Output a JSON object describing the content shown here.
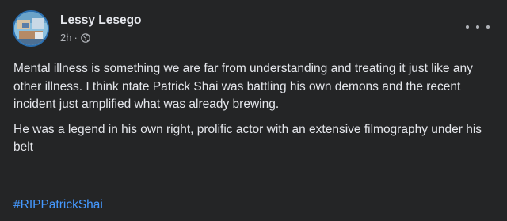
{
  "post": {
    "author": "Lessy Lesego",
    "time": "2h",
    "separator": "·",
    "privacy_icon": "globe-icon",
    "more_icon": "more-options-icon",
    "paragraphs": [
      "Mental illness is something we are far from understanding and treating it just like any other illness. I think ntate Patrick Shai was battling his own demons and the recent incident just amplified what was already brewing.",
      "He was a legend in his own right, prolific actor with an extensive filmography under his belt"
    ],
    "hashtag": "#RIPPatrickShai"
  },
  "colors": {
    "background": "#242526",
    "text_primary": "#e4e6eb",
    "text_secondary": "#b0b3b8",
    "link": "#4599ff",
    "avatar_ring": "#2b6fb0"
  }
}
